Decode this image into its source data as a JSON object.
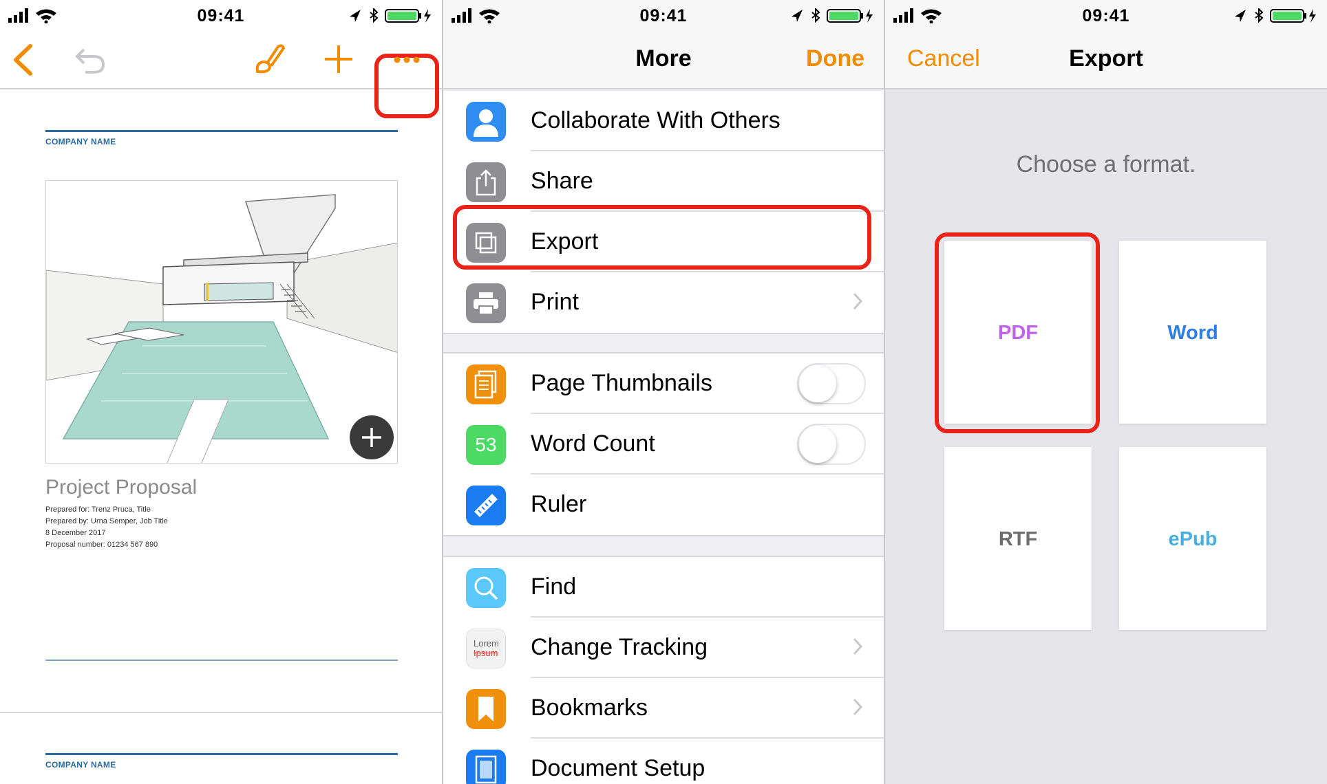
{
  "status_bar": {
    "time": "09:41"
  },
  "colors": {
    "accent": "#f08c00",
    "highlight": "#e8241a",
    "pdf": "#c063e8",
    "word": "#2f7ee8",
    "rtf": "#6e6e6e",
    "epub": "#49aee0"
  },
  "document": {
    "company_name_top": "COMPANY NAME",
    "title": "Project Proposal",
    "lines": [
      "Prepared for: Trenz Pruca, Title",
      "Prepared by: Urna Semper, Job Title",
      "8 December 2017",
      "Proposal number: 01234 567 890"
    ],
    "company_name_bottom": "COMPANY NAME"
  },
  "more_menu": {
    "title": "More",
    "done": "Done",
    "items": [
      {
        "label": "Collaborate With Others",
        "icon": "person-icon"
      },
      {
        "label": "Share",
        "icon": "share-icon"
      },
      {
        "label": "Export",
        "icon": "export-icon"
      },
      {
        "label": "Print",
        "icon": "printer-icon"
      },
      {
        "label": "Page Thumbnails",
        "icon": "thumbnails-icon",
        "toggle": false
      },
      {
        "label": "Word Count",
        "icon": "word-count-icon",
        "badge": "53",
        "toggle": false
      },
      {
        "label": "Ruler",
        "icon": "ruler-icon"
      },
      {
        "label": "Find",
        "icon": "find-icon"
      },
      {
        "label": "Change Tracking",
        "icon": "change-tracking-icon",
        "icon_text_top": "Lorem",
        "icon_text_bottom": "Ipsum"
      },
      {
        "label": "Bookmarks",
        "icon": "bookmark-icon"
      },
      {
        "label": "Document Setup",
        "icon": "document-setup-icon"
      }
    ]
  },
  "export": {
    "cancel": "Cancel",
    "title": "Export",
    "prompt": "Choose a format.",
    "formats": [
      "PDF",
      "Word",
      "RTF",
      "ePub"
    ]
  }
}
